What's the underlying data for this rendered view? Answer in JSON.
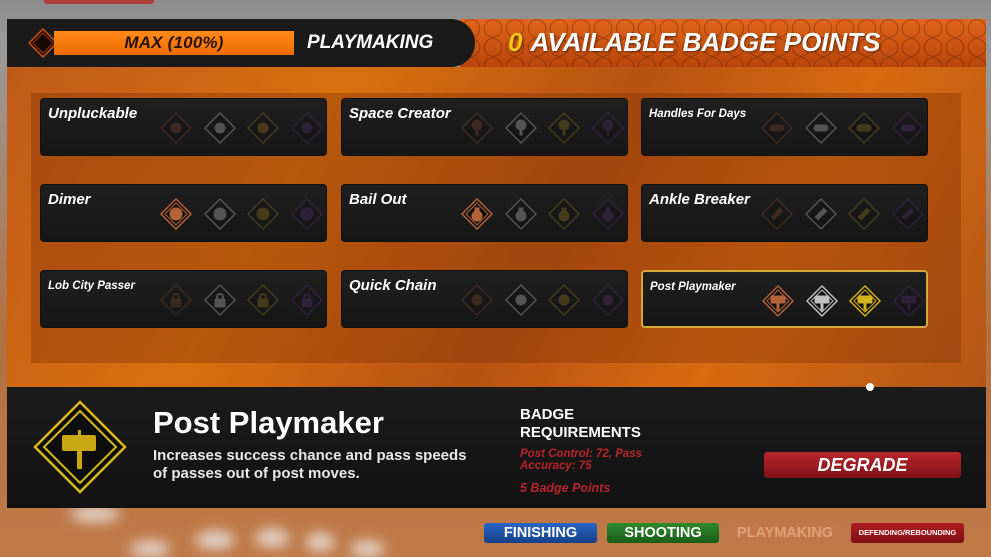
{
  "header": {
    "progress_label": "MAX (100%)",
    "progress_value_percent": 100,
    "category": "PLAYMAKING",
    "available_points_count": "0",
    "available_points_label": "AVAILABLE BADGE POINTS"
  },
  "tier_colors": {
    "bronze": "#b5643a",
    "silver": "#bfbfbf",
    "gold": "#d4b21c",
    "hof": "#7a3aa8"
  },
  "badges": [
    {
      "name": "Unpluckable",
      "icon": "hand-icon",
      "unlocked_tiers": 0,
      "selected": false,
      "small": false
    },
    {
      "name": "Space Creator",
      "icon": "map-pin-icon",
      "unlocked_tiers": 0,
      "selected": false,
      "small": false
    },
    {
      "name": "Handles For Days",
      "icon": "infinity-icon",
      "unlocked_tiers": 0,
      "selected": false,
      "small": true
    },
    {
      "name": "Dimer",
      "icon": "dollar-icon",
      "unlocked_tiers": 1,
      "selected": false,
      "small": false
    },
    {
      "name": "Bail Out",
      "icon": "money-bag-icon",
      "unlocked_tiers": 1,
      "selected": false,
      "small": false
    },
    {
      "name": "Ankle Breaker",
      "icon": "broken-bone-icon",
      "unlocked_tiers": 0,
      "selected": false,
      "small": false
    },
    {
      "name": "Lob City Passer",
      "icon": "padlock-icon",
      "unlocked_tiers": 0,
      "selected": false,
      "small": true
    },
    {
      "name": "Quick Chain",
      "icon": "chain-icon",
      "unlocked_tiers": 0,
      "selected": false,
      "small": false
    },
    {
      "name": "Post Playmaker",
      "icon": "signpost-icon",
      "unlocked_tiers": 3,
      "selected": true,
      "small": true
    }
  ],
  "detail": {
    "icon": "signpost-icon",
    "title": "Post Playmaker",
    "description": "Increases success chance and pass speeds of passes out of post moves.",
    "requirements_title": "BADGE REQUIREMENTS",
    "requirements_text": "Post Control: 72, Pass Accuracy: 75",
    "badge_points": "5 Badge Points",
    "action_button": "DEGRADE"
  },
  "categories": [
    {
      "label": "FINISHING",
      "active": false
    },
    {
      "label": "SHOOTING",
      "active": false
    },
    {
      "label": "PLAYMAKING",
      "active": true
    },
    {
      "label": "DEFENDING/REBOUNDING",
      "active": false
    }
  ]
}
